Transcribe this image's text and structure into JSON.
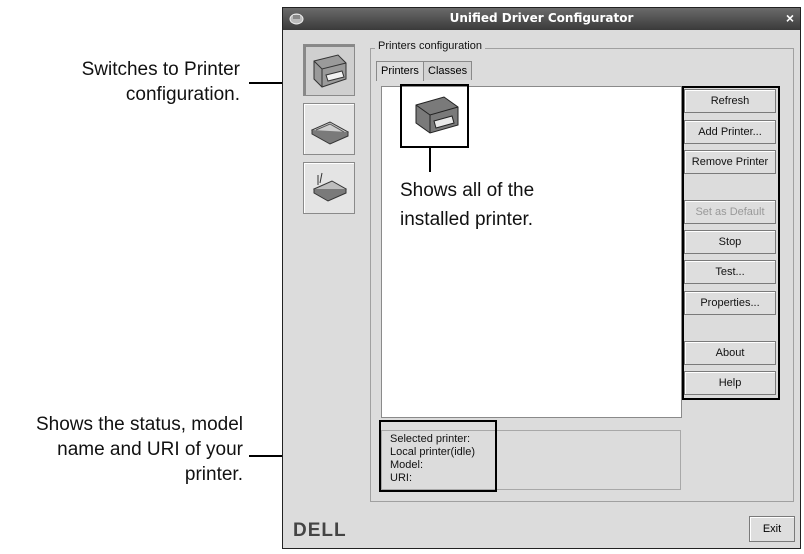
{
  "annotations": {
    "printer_config": [
      "Switches to Printer",
      "configuration."
    ],
    "status": [
      "Shows the status, model",
      "name and URI of your",
      "printer."
    ],
    "installed": [
      "Shows all of the",
      "installed printer."
    ]
  },
  "window": {
    "title": "Unified Driver Configurator",
    "close_glyph": "×"
  },
  "sidebar": {
    "items": [
      {
        "name": "printer-icon"
      },
      {
        "name": "scanner-icon"
      },
      {
        "name": "port-icon"
      }
    ]
  },
  "printers_group": {
    "label": "Printers configuration",
    "tabs": [
      "Printers",
      "Classes"
    ]
  },
  "buttons": {
    "refresh": "Refresh",
    "add_printer": "Add Printer...",
    "remove_printer": "Remove Printer",
    "set_default": "Set as Default",
    "stop": "Stop",
    "test": "Test...",
    "properties": "Properties...",
    "about": "About",
    "help": "Help",
    "exit": "Exit"
  },
  "selected_printer": {
    "label": "Selected printer:",
    "status": "Local printer(idle)",
    "model": "Model:",
    "uri": "URI:"
  },
  "brand": "DELL"
}
